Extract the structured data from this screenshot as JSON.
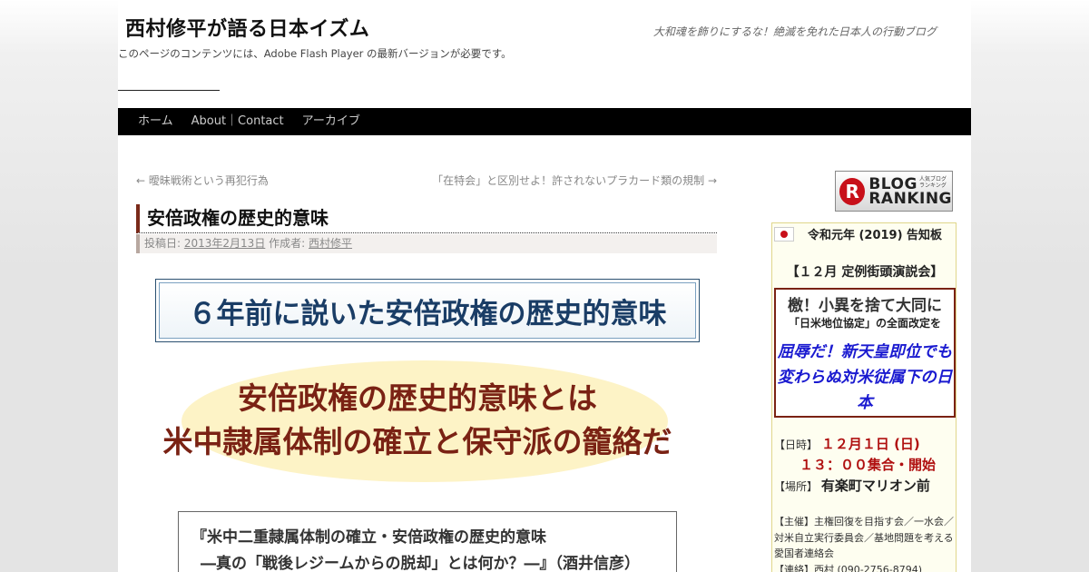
{
  "header": {
    "site_title": "西村修平が語る日本イズム",
    "site_description": "大和魂を飾りにするな！絶滅を免れた日本人の行動ブログ",
    "flash_note": "このページのコンテンツには、Adobe Flash Player の最新バージョンが必要です。"
  },
  "nav": {
    "items": [
      "ホーム",
      "About｜Contact",
      "アーカイブ"
    ]
  },
  "post_nav": {
    "prev": "← 曖昧戦術という再犯行為",
    "next": "「在特会」と区別せよ！許されないプラカード類の規制 →"
  },
  "post": {
    "title": "安倍政権の歴史的意味",
    "meta_posted": "投稿日:",
    "meta_date": "2013年2月13日",
    "meta_by": "作成者:",
    "meta_author": "西村修平",
    "headline": "６年前に説いた安倍政権の歴史的意味",
    "big_line1": "安倍政権の歴史的意味とは",
    "big_line2": "米中隷属体制の確立と保守派の籠絡だ",
    "quote_line1": "『米中二重隷属体制の確立・安倍政権の歴史的意味",
    "quote_line2": "―真の「戦後レジームからの脱却」とは何か？―』（酒井信彦）"
  },
  "sidebar": {
    "ranking_logo": "R",
    "ranking_big": "BLOG",
    "ranking_big2": "RANKING",
    "ranking_small": "人気ブログランキング",
    "notice_title": "令和元年 (2019) 告知板",
    "notice_sub": "【１２月 定例街頭演説会】",
    "box_line1": "檄！小異を捨て大同に",
    "box_line2": "「日米地位協定」の全面改定を",
    "box_line3": "屈辱だ！新天皇即位でも変わらぬ対米従属下の日本",
    "date_label": "【日時】",
    "date_value": "１２月１日 (日)",
    "time_value": "１３：００集合・開始",
    "place_label": "【場所】",
    "place_value": "有楽町マリオン前",
    "organizer": "【主催】主権回復を目指す会／一水会／対米自立実行委員会／基地問題を考える愛国者連絡会",
    "contact": "【連絡】西村 (090-2756-8794)"
  }
}
